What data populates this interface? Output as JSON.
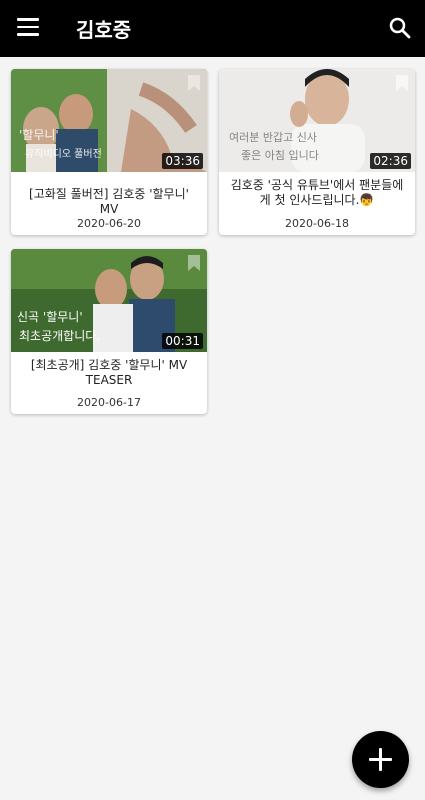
{
  "appbar": {
    "title": "김호중",
    "menu_icon": "hamburger-menu-icon",
    "search_icon": "search-icon"
  },
  "videos": [
    {
      "title": "[고화질 풀버전] 김호중 '할무니' MV",
      "date": "2020-06-20",
      "duration": "03:36",
      "thumb_text": "'할무니' 뮤직비디오 풀버전"
    },
    {
      "title": "김호중 '공식 유튜브'에서 팬분들에게 첫 인사드립니다.👦",
      "date": "2020-06-18",
      "duration": "02:36",
      "thumb_text": "여러분 반갑고 신사..."
    },
    {
      "title": "[최초공개] 김호중 '할무니' MV TEASER",
      "date": "2020-06-17",
      "duration": "00:31",
      "thumb_text": "신곡 '할무니' 최초공개합니다."
    }
  ],
  "fab": {
    "icon": "plus-icon"
  },
  "colors": {
    "appbar": "#000000",
    "background": "#f4f4f4",
    "fab": "#000000"
  }
}
